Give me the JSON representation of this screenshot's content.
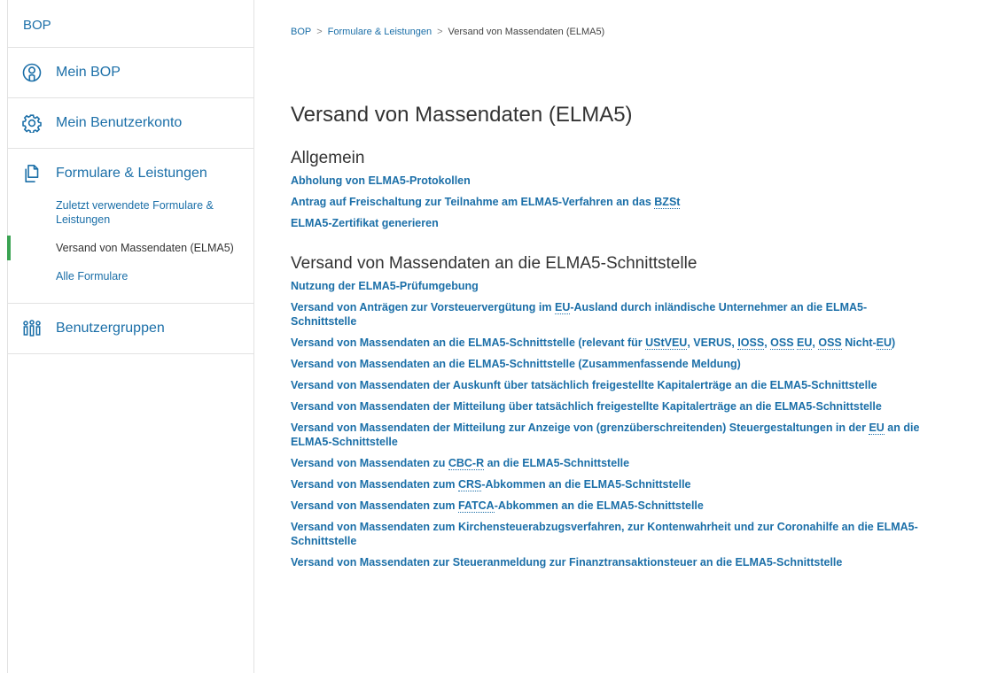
{
  "sidebar": {
    "title": "BOP",
    "items": [
      {
        "label": "Mein BOP",
        "icon": "person-circle-icon"
      },
      {
        "label": "Mein Benutzerkonto",
        "icon": "gear-icon"
      },
      {
        "label": "Formulare & Leistungen",
        "icon": "documents-icon"
      },
      {
        "label": "Benutzergruppen",
        "icon": "user-group-icon"
      }
    ],
    "sub_items": [
      {
        "label": "Zuletzt verwendete Formulare & Leistungen",
        "active": false
      },
      {
        "label": "Versand von Massendaten (ELMA5)",
        "active": true
      },
      {
        "label": "Alle Formulare",
        "active": false
      }
    ]
  },
  "breadcrumb": {
    "items": [
      "BOP",
      "Formulare & Leistungen",
      "Versand von Massendaten (ELMA5)"
    ],
    "separator": ">"
  },
  "page_title": "Versand von Massendaten (ELMA5)",
  "sections": [
    {
      "heading": "Allgemein",
      "links": [
        [
          {
            "t": "Abholung von ELMA5-Protokollen"
          }
        ],
        [
          {
            "t": "Antrag auf Freischaltung zur Teilnahme am ELMA5-Verfahren an das "
          },
          {
            "t": "BZSt",
            "abbr": true
          }
        ],
        [
          {
            "t": "ELMA5-Zertifikat generieren"
          }
        ]
      ]
    },
    {
      "heading": "Versand von Massendaten an die ELMA5-Schnittstelle",
      "links": [
        [
          {
            "t": "Nutzung der ELMA5-Prüfumgebung"
          }
        ],
        [
          {
            "t": "Versand von Anträgen zur Vorsteuervergütung im "
          },
          {
            "t": "EU",
            "abbr": true
          },
          {
            "t": "-Ausland durch inländische Unternehmer an die ELMA5-Schnittstelle"
          }
        ],
        [
          {
            "t": "Versand von Massendaten an die ELMA5-Schnittstelle (relevant für "
          },
          {
            "t": "UStVEU",
            "abbr": true
          },
          {
            "t": ", VERUS, "
          },
          {
            "t": "IOSS",
            "abbr": true
          },
          {
            "t": ", "
          },
          {
            "t": "OSS",
            "abbr": true
          },
          {
            "t": " "
          },
          {
            "t": "EU",
            "abbr": true
          },
          {
            "t": ", "
          },
          {
            "t": "OSS",
            "abbr": true
          },
          {
            "t": " Nicht-"
          },
          {
            "t": "EU",
            "abbr": true
          },
          {
            "t": ")"
          }
        ],
        [
          {
            "t": "Versand von Massendaten an die ELMA5-Schnittstelle (Zusammenfassende Meldung)"
          }
        ],
        [
          {
            "t": "Versand von Massendaten der Auskunft über tatsächlich freigestellte Kapitalerträge an die ELMA5-Schnittstelle"
          }
        ],
        [
          {
            "t": "Versand von Massendaten der Mitteilung über tatsächlich freigestellte Kapitalerträge an die ELMA5-Schnittstelle"
          }
        ],
        [
          {
            "t": "Versand von Massendaten der Mitteilung zur Anzeige von (grenzüberschreitenden) Steuergestaltungen in der "
          },
          {
            "t": "EU",
            "abbr": true
          },
          {
            "t": " an die ELMA5-Schnittstelle"
          }
        ],
        [
          {
            "t": "Versand von Massendaten zu "
          },
          {
            "t": "CBC-R",
            "abbr": true
          },
          {
            "t": " an die ELMA5-Schnittstelle"
          }
        ],
        [
          {
            "t": "Versand von Massendaten zum "
          },
          {
            "t": "CRS",
            "abbr": true
          },
          {
            "t": "-Abkommen an die ELMA5-Schnittstelle"
          }
        ],
        [
          {
            "t": "Versand von Massendaten zum "
          },
          {
            "t": "FATCA",
            "abbr": true
          },
          {
            "t": "-Abkommen an die ELMA5-Schnittstelle"
          }
        ],
        [
          {
            "t": "Versand von Massendaten zum Kirchensteuerabzugsverfahren, zur Kontenwahrheit und zur Coronahilfe an die ELMA5-Schnittstelle"
          }
        ],
        [
          {
            "t": "Versand von Massendaten zur Steueranmeldung zur Finanztransaktionsteuer an die ELMA5-Schnittstelle"
          }
        ]
      ]
    }
  ],
  "colors": {
    "link": "#1b6fa8",
    "active_marker": "#3aa352",
    "text": "#333333",
    "border": "#e2e2e2"
  }
}
